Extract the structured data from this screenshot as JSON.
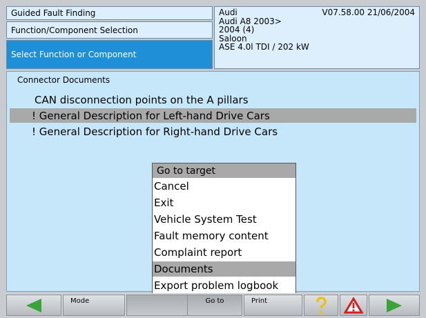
{
  "header": {
    "left": {
      "row1": "Guided Fault Finding",
      "row2": "Function/Component Selection",
      "row3": "Select Function or Component"
    },
    "right": {
      "make": "Audi",
      "version": "V07.58.00 21/06/2004",
      "model": "Audi A8 2003>",
      "year": "2004 (4)",
      "body": "Saloon",
      "engine": "ASE 4.0l TDI / 202 kW"
    }
  },
  "main": {
    "section_title": "Connector Documents",
    "items": [
      "CAN disconnection points on the A pillars",
      "! General Description for Left-hand Drive Cars",
      "! General Description for Right-hand Drive Cars"
    ]
  },
  "popup": {
    "title": "Go to target",
    "items": [
      "Cancel",
      "Exit",
      "Vehicle System Test",
      "Fault memory content",
      "Complaint report",
      "Documents",
      "Export problem logbook"
    ],
    "selected": "Documents"
  },
  "toolbar": {
    "mode_label": "Mode",
    "goto_label": "Go to",
    "print_label": "Print",
    "icons": {
      "back": "arrow-left-icon",
      "help": "question-icon",
      "warning": "warning-icon",
      "forward": "arrow-right-icon"
    },
    "colors": {
      "arrow": "#3aa33a",
      "help": "#e8c21a",
      "warning": "#d61f1f"
    }
  }
}
